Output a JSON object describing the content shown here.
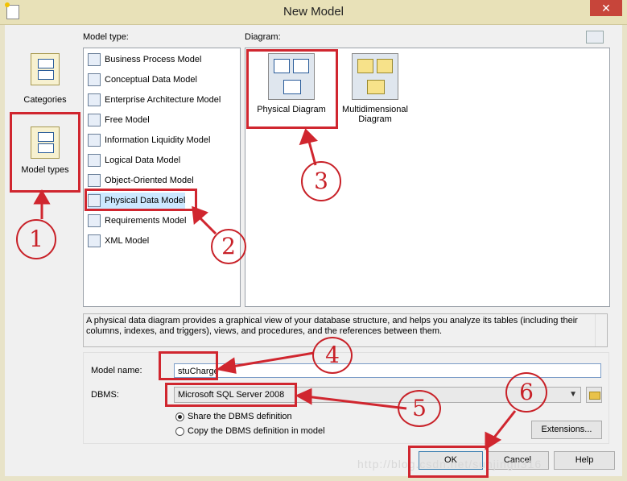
{
  "window": {
    "title": "New Model",
    "close_label": "✕"
  },
  "labels": {
    "model_type": "Model type:",
    "diagram": "Diagram:"
  },
  "categories": [
    {
      "label": "Categories"
    },
    {
      "label": "Model types"
    }
  ],
  "model_types": [
    "Business Process Model",
    "Conceptual Data Model",
    "Enterprise Architecture Model",
    "Free Model",
    "Information Liquidity Model",
    "Logical Data Model",
    "Object-Oriented Model",
    "Physical Data Model",
    "Requirements Model",
    "XML Model"
  ],
  "diagrams": [
    {
      "label": "Physical Diagram"
    },
    {
      "label": "Multidimensional Diagram"
    }
  ],
  "description": "A physical data diagram provides a graphical view of your database structure, and helps you analyze its tables (including their columns, indexes, and triggers), views, and procedures, and the references between them.",
  "form": {
    "model_name_label": "Model name:",
    "model_name_value": "stuCharge",
    "dbms_label": "DBMS:",
    "dbms_value": "Microsoft SQL Server 2008",
    "radio_share": "Share the DBMS definition",
    "radio_copy": "Copy the DBMS definition in model",
    "extensions": "Extensions..."
  },
  "buttons": {
    "ok": "OK",
    "cancel": "Cancel",
    "help": "Help"
  },
  "annotations": {
    "n1": "1",
    "n2": "2",
    "n3": "3",
    "n4": "4",
    "n5": "5",
    "n6": "6"
  },
  "watermark": "http://blog.csdn.net/sunjingli316",
  "colors": {
    "annotation": "#d0262f",
    "selection": "#cce8ff"
  }
}
